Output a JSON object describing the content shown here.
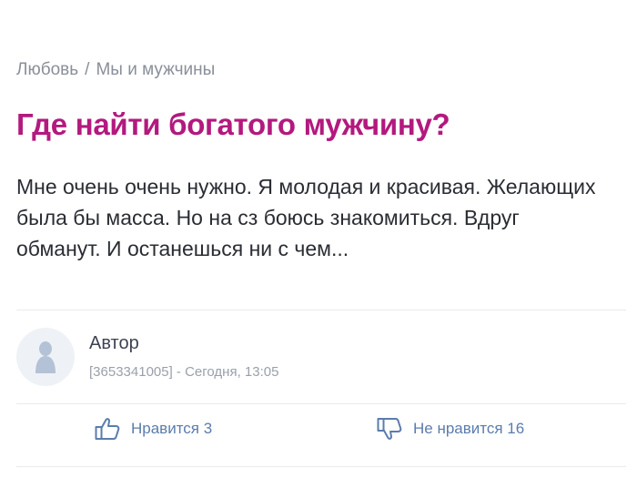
{
  "breadcrumb": {
    "category": "Любовь",
    "separator": "/",
    "subcategory": "Мы и мужчины"
  },
  "post": {
    "title": "Где найти богатого мужчину?",
    "body": "Мне очень очень нужно. Я молодая и красивая. Желающих была бы масса. Но на сз боюсь знакомиться. Вдруг обманут. И останешься ни с чем..."
  },
  "author": {
    "name": "Автор",
    "meta": "[3653341005] - Сегодня, 13:05",
    "avatar_icon": "user-silhouette-icon"
  },
  "reactions": {
    "like_label": "Нравится 3",
    "dislike_label": "Не нравится 16",
    "like_icon": "thumbs-up-icon",
    "dislike_icon": "thumbs-down-icon"
  },
  "colors": {
    "title": "#b3197e",
    "link": "#5b7cad",
    "muted": "#8a8f99"
  }
}
